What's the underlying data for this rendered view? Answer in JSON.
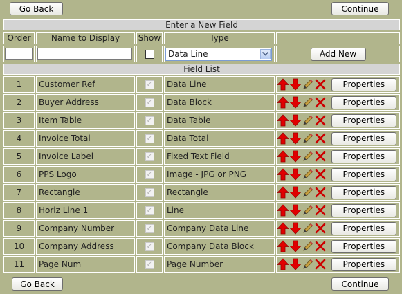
{
  "nav": {
    "back_label": "Go Back",
    "continue_label": "Continue"
  },
  "new_field": {
    "section_title": "Enter a New Field",
    "headers": {
      "order": "Order",
      "name": "Name to Display",
      "show": "Show",
      "type": "Type"
    },
    "order_value": "",
    "name_value": "",
    "type_selected": "Data Line",
    "add_label": "Add New"
  },
  "field_list": {
    "section_title": "Field List",
    "properties_label": "Properties",
    "rows": [
      {
        "order": "1",
        "name": "Customer Ref",
        "type": "Data Line"
      },
      {
        "order": "2",
        "name": "Buyer Address",
        "type": "Data Block"
      },
      {
        "order": "3",
        "name": "Item Table",
        "type": "Data Table"
      },
      {
        "order": "4",
        "name": "Invoice Total",
        "type": "Data Total"
      },
      {
        "order": "5",
        "name": "Invoice Label",
        "type": "Fixed Text Field"
      },
      {
        "order": "6",
        "name": "PPS Logo",
        "type": "Image - JPG or PNG"
      },
      {
        "order": "7",
        "name": "Rectangle",
        "type": "Rectangle"
      },
      {
        "order": "8",
        "name": "Horiz Line 1",
        "type": "Line"
      },
      {
        "order": "9",
        "name": "Company Number",
        "type": "Company Data Line"
      },
      {
        "order": "10",
        "name": "Company Address",
        "type": "Company Data Block"
      },
      {
        "order": "11",
        "name": "Page Num",
        "type": "Page Number"
      }
    ]
  },
  "colors": {
    "background": "#b1b58c",
    "band": "#d4d4d4",
    "arrow": "#e00000",
    "delete": "#cc0000"
  }
}
